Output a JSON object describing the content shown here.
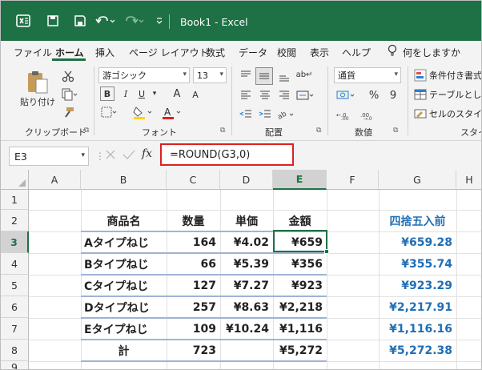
{
  "app": {
    "title": "Book1  -  Excel",
    "icons": [
      "excel-logo-icon",
      "save-icon",
      "undo-icon",
      "redo-icon",
      "customize-qat-icon"
    ]
  },
  "menu": {
    "tabs": [
      "ファイル",
      "ホーム",
      "挿入",
      "ページ レイアウト",
      "数式",
      "データ",
      "校閲",
      "表示",
      "ヘルプ"
    ],
    "active": "ホーム",
    "search_hint": "何をしますか"
  },
  "ribbon": {
    "clipboard": {
      "paste_label": "貼り付け",
      "group_label": "クリップボード"
    },
    "font": {
      "font_name": "游ゴシック",
      "font_size": "13",
      "bold": "B",
      "italic": "I",
      "underline": "U",
      "grow": "A",
      "shrink": "A",
      "fill_color": "#ffd500",
      "font_color": "#e02020",
      "group_label": "フォント"
    },
    "alignment": {
      "wrap_label": "ab↵",
      "group_label": "配置"
    },
    "number": {
      "format": "通貨",
      "percent": "%",
      "comma": "9",
      "group_label": "数値"
    },
    "styles": {
      "conditional": "条件付き書式",
      "table": "テーブルとして",
      "cell_styles": "セルのスタイル",
      "group_label": "スタイル"
    }
  },
  "formula_bar": {
    "name_box": "E3",
    "fx": "fx",
    "formula": "=ROUND(G3,0)"
  },
  "sheet": {
    "columns": [
      "A",
      "B",
      "C",
      "D",
      "E",
      "F",
      "G",
      "H"
    ],
    "rows": [
      "1",
      "2",
      "3",
      "4",
      "5",
      "6",
      "7",
      "8",
      "9"
    ],
    "selected_cell": "E3",
    "headers": {
      "b": "商品名",
      "c": "数量",
      "d": "単価",
      "e": "金額",
      "g": "四捨五入前"
    },
    "data": [
      {
        "name": "Aタイプねじ",
        "qty": "164",
        "price": "¥4.02",
        "amount": "¥659",
        "raw": "¥659.28"
      },
      {
        "name": "Bタイプねじ",
        "qty": "66",
        "price": "¥5.39",
        "amount": "¥356",
        "raw": "¥355.74"
      },
      {
        "name": "Cタイプねじ",
        "qty": "127",
        "price": "¥7.27",
        "amount": "¥923",
        "raw": "¥923.29"
      },
      {
        "name": "Dタイプねじ",
        "qty": "257",
        "price": "¥8.63",
        "amount": "¥2,218",
        "raw": "¥2,217.91"
      },
      {
        "name": "Eタイプねじ",
        "qty": "109",
        "price": "¥10.24",
        "amount": "¥1,116",
        "raw": "¥1,116.16"
      }
    ],
    "total": {
      "label": "計",
      "qty": "723",
      "amount": "¥5,272",
      "raw": "¥5,272.38"
    }
  }
}
